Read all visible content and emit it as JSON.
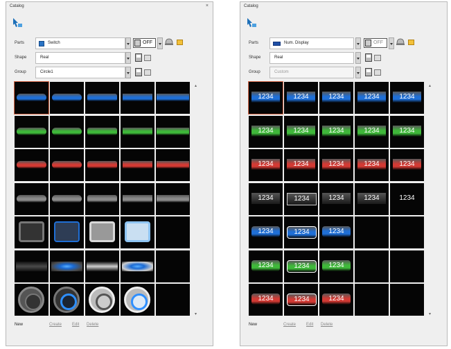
{
  "left": {
    "title": "Catalog",
    "close_glyph": "×",
    "parts": {
      "label": "Parts",
      "value": "Switch",
      "off_text": "OFF"
    },
    "shape": {
      "label": "Shape",
      "value": "Real"
    },
    "group": {
      "label": "Group",
      "value": "Circle1"
    },
    "links": [
      "New",
      "Create",
      "Edit",
      "Delete"
    ]
  },
  "right": {
    "title": "Catalog",
    "parts": {
      "label": "Parts",
      "value": "Num. Display",
      "off_text": "OFF"
    },
    "shape": {
      "label": "Shape",
      "value": "Real"
    },
    "group": {
      "label": "Group",
      "value": "Custom"
    },
    "number_label": "1234",
    "links": [
      "New",
      "Create",
      "Edit",
      "Delete"
    ]
  },
  "icons": {
    "pointer": "pointer-arrow-icon",
    "save": "save-icon",
    "print": "print-icon",
    "off_state": "off-state-icon",
    "bell": "bell-icon",
    "folder": "folder-icon",
    "scroll_up": "scroll-up-icon",
    "scroll_down": "scroll-down-icon"
  },
  "colors": {
    "blue": "#1f6fd6",
    "green": "#3fb83a",
    "red": "#d23a34",
    "grey": "#8a8a8a",
    "dark": "#2a2a2a",
    "selection": "#d86a4a"
  },
  "left_grid_rows": [
    {
      "kind": "pill",
      "color": "blue",
      "count": 5
    },
    {
      "kind": "pill",
      "color": "green",
      "count": 5
    },
    {
      "kind": "pill",
      "color": "red",
      "count": 5
    },
    {
      "kind": "pill",
      "color": "grey",
      "count": 5
    },
    {
      "kind": "square",
      "count": 4
    },
    {
      "kind": "bar",
      "count": 4
    },
    {
      "kind": "circle",
      "count": 4
    }
  ],
  "right_grid_rows": [
    {
      "color": "blue",
      "count": 5
    },
    {
      "color": "green",
      "count": 5
    },
    {
      "color": "red",
      "count": 5
    },
    {
      "color": "dark",
      "count": 5
    },
    {
      "color": "blue",
      "count": 3
    },
    {
      "color": "green",
      "count": 3
    },
    {
      "color": "red",
      "count": 3
    }
  ]
}
